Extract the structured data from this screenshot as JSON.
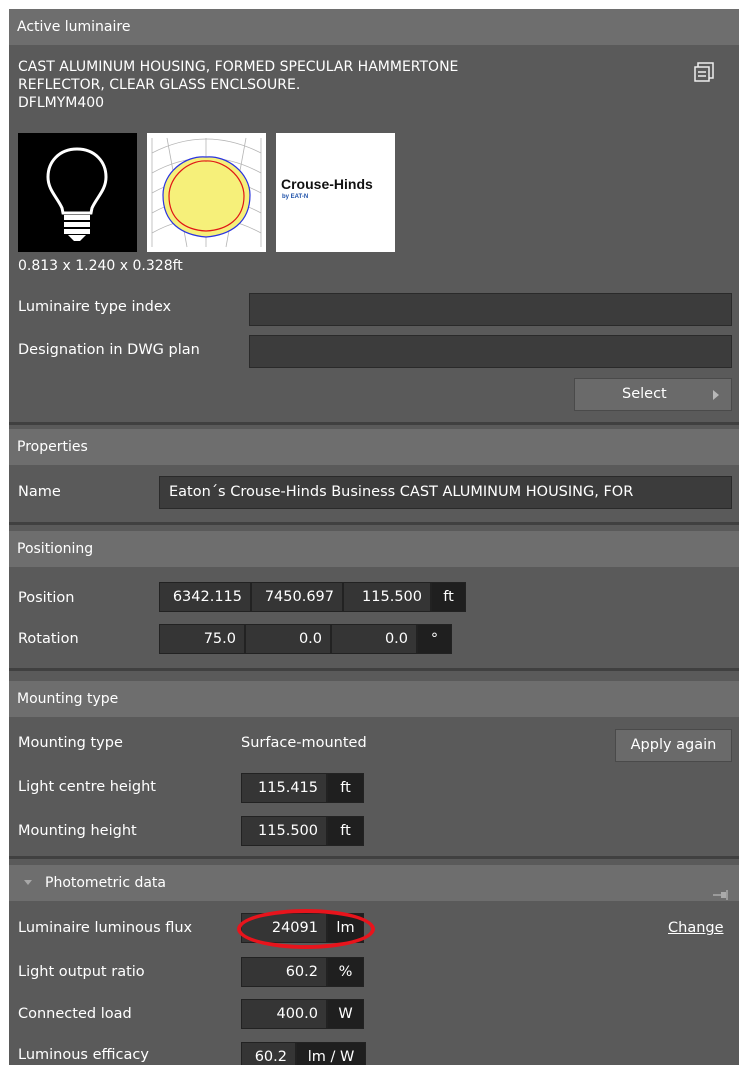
{
  "active_luminaire": {
    "header": "Active luminaire",
    "description_line1": "CAST ALUMINUM HOUSING, FORMED SPECULAR HAMMERTONE",
    "description_line2": "REFLECTOR, CLEAR GLASS ENCLSOURE.",
    "model_code": "DFLMYM400",
    "dimensions": "0.813 x 1.240 x 0.328ft",
    "brand_logo": {
      "name": "Crouse-Hinds",
      "sub": "by EAT-N"
    },
    "type_index_label": "Luminaire type index",
    "type_index_value": "",
    "designation_label": "Designation in DWG plan",
    "designation_value": "",
    "select_label": "Select"
  },
  "properties": {
    "header": "Properties",
    "name_label": "Name",
    "name_value": "Eaton´s Crouse-Hinds Business CAST ALUMINUM HOUSING, FOR"
  },
  "positioning": {
    "header": "Positioning",
    "position_label": "Position",
    "position_values": [
      "6342.115",
      "7450.697",
      "115.500"
    ],
    "position_unit": "ft",
    "rotation_label": "Rotation",
    "rotation_values": [
      "75.0",
      "0.0",
      "0.0"
    ],
    "rotation_unit": "°"
  },
  "mounting": {
    "header": "Mounting type",
    "type_label": "Mounting type",
    "type_value": "Surface-mounted",
    "apply_label": "Apply again",
    "light_centre_label": "Light centre height",
    "light_centre_value": "115.415",
    "light_centre_unit": "ft",
    "mounting_height_label": "Mounting height",
    "mounting_height_value": "115.500",
    "mounting_height_unit": "ft"
  },
  "photometric": {
    "header": "Photometric data",
    "flux_label": "Luminaire luminous flux",
    "flux_value": "24091",
    "flux_unit": "lm",
    "change_label": "Change",
    "lor_label": "Light output ratio",
    "lor_value": "60.2",
    "lor_unit": "%",
    "load_label": "Connected load",
    "load_value": "400.0",
    "load_unit": "W",
    "efficacy_label": "Luminous efficacy",
    "efficacy_value": "60.2",
    "efficacy_unit": "lm / W"
  },
  "colors": {
    "panel_bg": "#5a5a5a",
    "header_bg": "#6e6e6e",
    "field_bg": "#3c3c3c",
    "highlight": "#e8141c"
  }
}
